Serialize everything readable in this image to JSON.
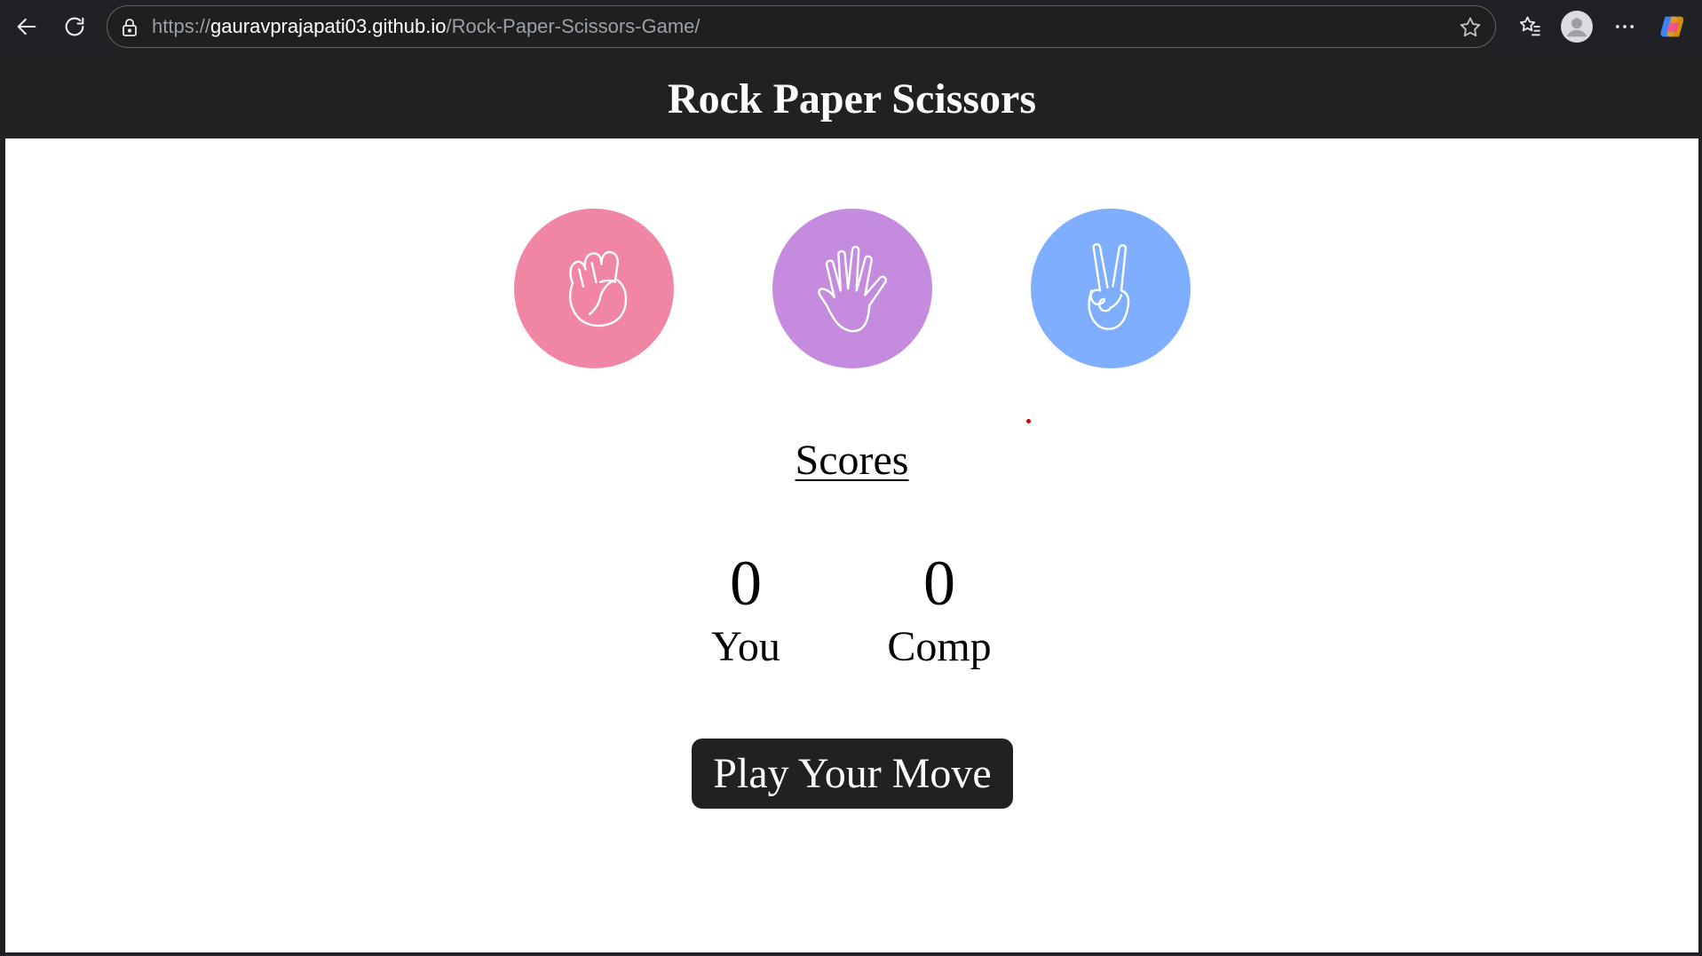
{
  "browser": {
    "url_scheme": "https://",
    "url_host": "gauravprajapati03.github.io",
    "url_path": "/Rock-Paper-Scissors-Game/",
    "icons": [
      "back-arrow-icon",
      "refresh-icon",
      "lock-icon",
      "star-icon",
      "favorites-icon",
      "profile-avatar-icon",
      "more-icon",
      "copilot-icon"
    ]
  },
  "header": {
    "title": "Rock Paper Scissors",
    "background": "#212121"
  },
  "choices": [
    {
      "name": "rock",
      "icon": "fist-icon",
      "color": "#f085a4"
    },
    {
      "name": "paper",
      "icon": "open-hand-icon",
      "color": "#c48bdf"
    },
    {
      "name": "scissors",
      "icon": "peace-sign-icon",
      "color": "#7faefe"
    }
  ],
  "scores": {
    "heading": "Scores",
    "user": {
      "value": "0",
      "label": "You"
    },
    "computer": {
      "value": "0",
      "label": "Comp"
    }
  },
  "message": {
    "text": "Play Your Move",
    "background": "#212121"
  }
}
